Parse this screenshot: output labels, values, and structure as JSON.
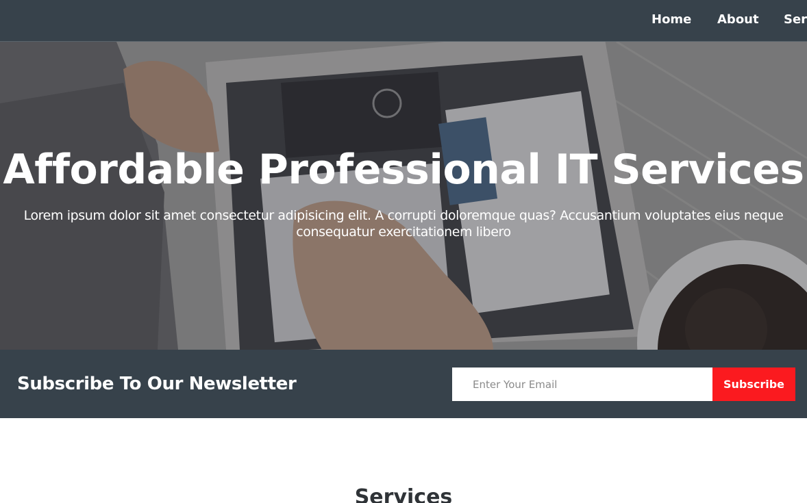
{
  "nav": {
    "items": [
      {
        "label": "Home"
      },
      {
        "label": "About"
      },
      {
        "label": "Services"
      }
    ]
  },
  "hero": {
    "title": "Affordable Professional IT Services",
    "text": "Lorem ipsum dolor sit amet consectetur adipisicing elit. A corrupti doloremque quas? Accusantium voluptates eius neque consequatur exercitationem libero"
  },
  "newsletter": {
    "title": "Subscribe To Our Newsletter",
    "email_placeholder": "Enter Your Email",
    "email_value": "",
    "button_label": "Subscribe"
  },
  "services": {
    "heading": "Services"
  },
  "colors": {
    "nav_bg": "#37424b",
    "newsletter_bg": "#37424b",
    "accent": "#fb1a1f",
    "text_light": "#ffffff",
    "heading_dark": "#2f3337"
  },
  "icons": {
    "hero_image": "laptop-photo"
  }
}
